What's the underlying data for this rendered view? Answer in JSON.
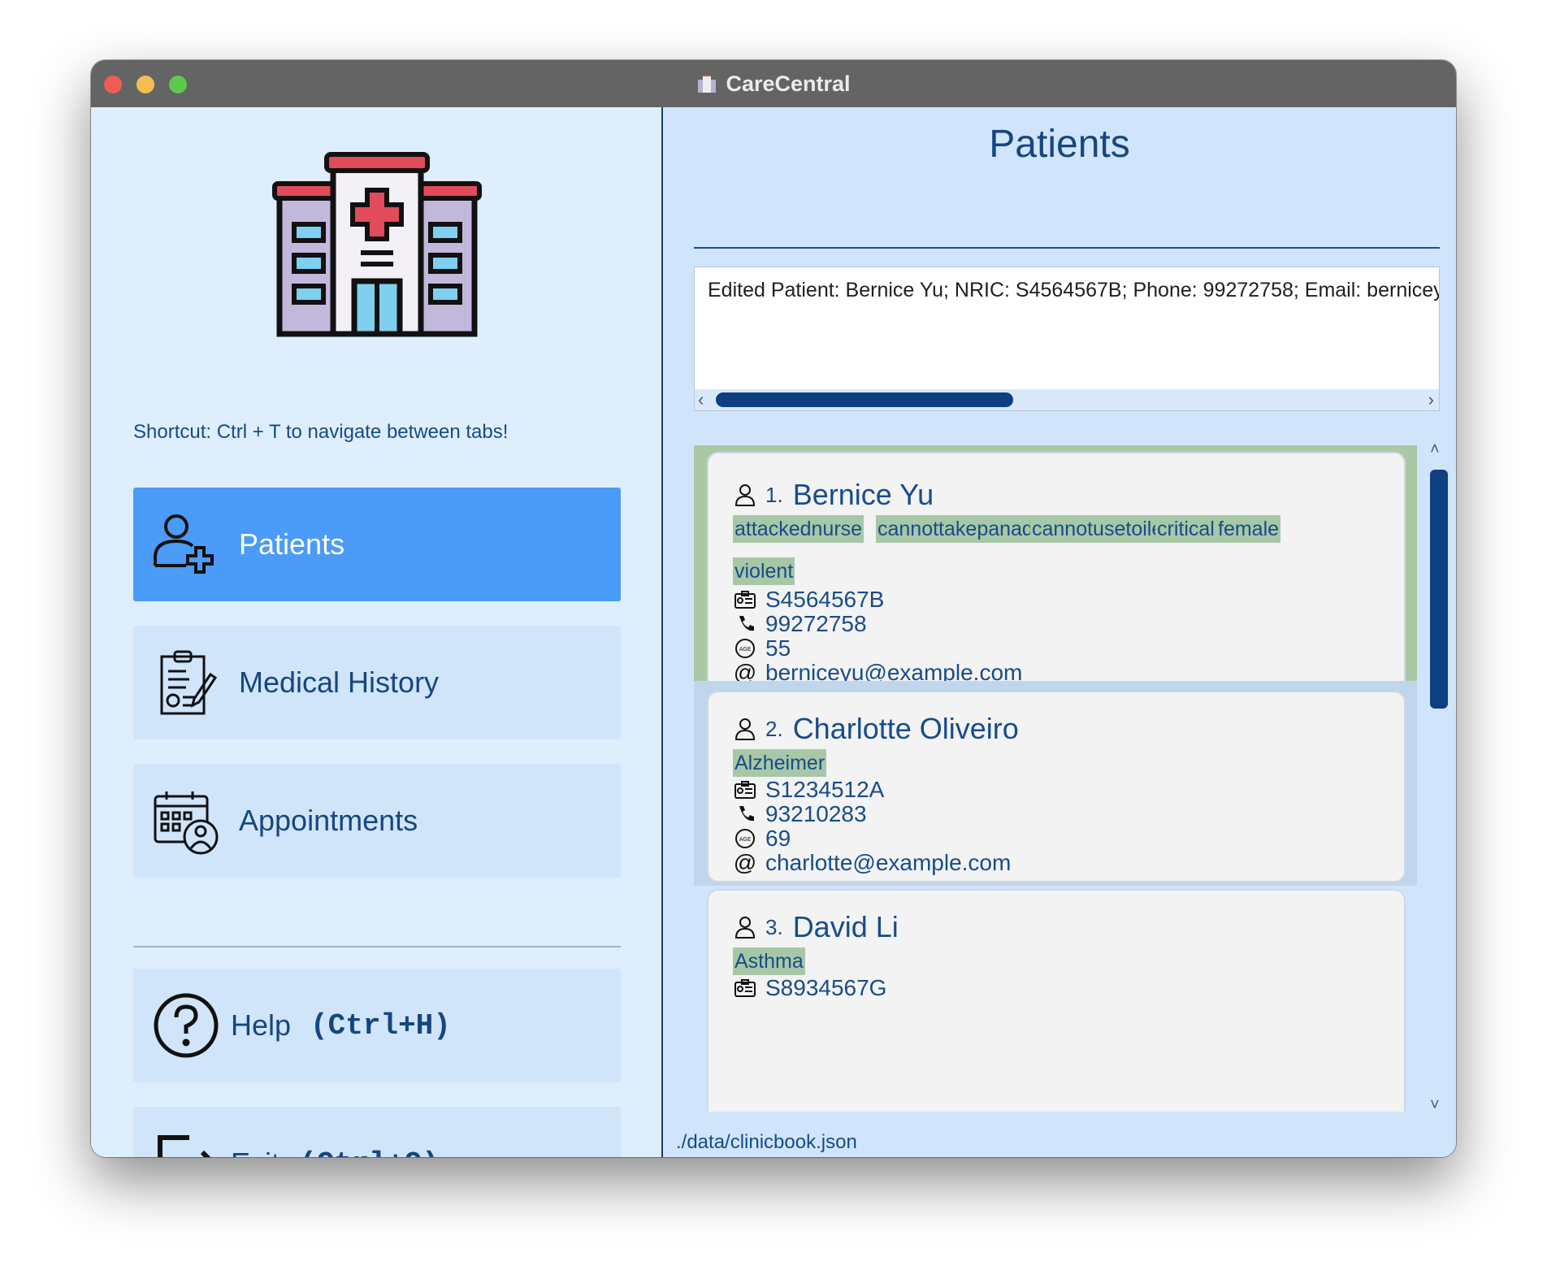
{
  "window": {
    "title": "CareCentral"
  },
  "sidebar": {
    "shortcut_hint": "Shortcut: Ctrl + T to navigate between tabs!",
    "items": [
      {
        "label": "Patients",
        "icon": "add-user-icon",
        "active": true
      },
      {
        "label": "Medical History",
        "icon": "clipboard-icon",
        "active": false
      },
      {
        "label": "Appointments",
        "icon": "calendar-doctor-icon",
        "active": false
      }
    ],
    "help": {
      "label": "Help",
      "shortcut": "(Ctrl+H)"
    },
    "exit": {
      "label": "Exit",
      "shortcut": "(Ctrl+Q)"
    }
  },
  "main": {
    "title": "Patients",
    "command_input": {
      "value": "",
      "placeholder": ""
    },
    "result_text": "Edited Patient: Bernice Yu; NRIC: S4564567B; Phone: 99272758; Email: berniceyu",
    "patients": [
      {
        "index": "1.",
        "name": "Bernice Yu",
        "tags": [
          "attackednurse",
          "cannottakepanadol",
          "cannotusetoilet",
          "critical",
          "female",
          "violent"
        ],
        "nric": "S4564567B",
        "phone": "99272758",
        "age": "55",
        "email": "berniceyu@example.com",
        "selected": true
      },
      {
        "index": "2.",
        "name": "Charlotte Oliveiro",
        "tags": [
          "Alzheimer"
        ],
        "nric": "S1234512A",
        "phone": "93210283",
        "age": "69",
        "email": "charlotte@example.com",
        "selected": false
      },
      {
        "index": "3.",
        "name": "David Li",
        "tags": [
          "Asthma"
        ],
        "nric": "S8934567G",
        "phone": "",
        "age": "",
        "email": "",
        "selected": false
      }
    ]
  },
  "status_bar": {
    "path": "./data/clinicbook.json"
  },
  "colors": {
    "accent": "#4b9bf8",
    "text": "#174c8a",
    "tag": "#a7c7a7",
    "selected": "#a9c9a4"
  }
}
